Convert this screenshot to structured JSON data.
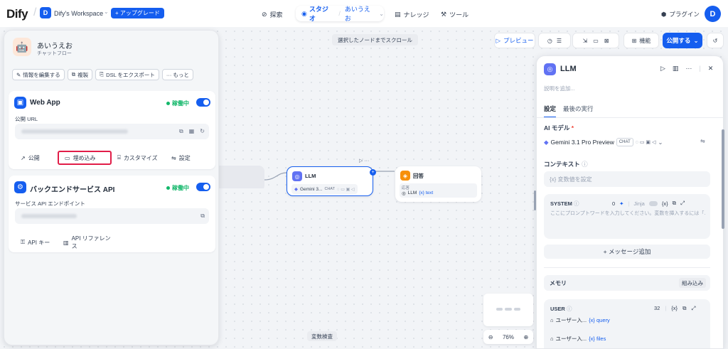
{
  "topbar": {
    "logo_main": "Dify",
    "workspace_initial": "D",
    "workspace_name": "Dify's Workspace",
    "upgrade_label": "+ アップグレード",
    "nav": {
      "explore": "探索",
      "studio": "スタジオ",
      "app_name": "あいうえお",
      "knowledge": "ナレッジ",
      "tools": "ツール"
    },
    "plugins_label": "プラグイン",
    "avatar_initial": "D"
  },
  "left_panel": {
    "app_name": "あいうえお",
    "app_type": "チャットフロー",
    "actions": [
      "情報を編集する",
      "複製",
      "DSL をエクスポート",
      "··· もっと"
    ],
    "web_app": {
      "title": "Web App",
      "status": "稼働中",
      "url_label": "公開 URL",
      "tabs": [
        "公開",
        "埋め込み",
        "カスタマイズ",
        "設定"
      ]
    },
    "backend_api": {
      "title": "バックエンドサービス API",
      "status": "稼働中",
      "endpoint_label": "サービス API エンドポイント",
      "links": [
        "API キー",
        "API リファレンス"
      ]
    }
  },
  "canvas": {
    "scroll_hint": "選択したノードまでスクロール",
    "llm_node": {
      "title": "LLM",
      "model": "Gemini 3...",
      "chip": "CHAT"
    },
    "answer_node": {
      "title": "回答",
      "label": "応答",
      "var_source": "LLM",
      "var_name": "{x} text"
    },
    "variable_inspect": "変数検査",
    "zoom": "76%"
  },
  "toolbar": {
    "preview": "プレビュー",
    "features": "機能",
    "publish": "公開する"
  },
  "right_panel": {
    "title": "LLM",
    "description_placeholder": "説明を追加...",
    "tabs": [
      "設定",
      "最後の実行"
    ],
    "ai_model_label": "AI モデル",
    "model_name": "Gemini 3.1 Pro Preview",
    "model_chip": "CHAT",
    "context_label": "コンテキスト",
    "context_placeholder": "{x}  変数値を設定",
    "system_label": "SYSTEM",
    "system_count": "0",
    "jinja_label": "Jinja",
    "system_placeholder": "ここにプロンプトワードを入力してください。変数を挿入するには「...",
    "add_message": "+ メッセージ追加",
    "memory_label": "メモリ",
    "memory_builtin": "組み込み",
    "user_label": "USER",
    "user_count": "32",
    "user_vars": [
      {
        "source": "ユーザー入...",
        "var": "{x} query"
      },
      {
        "source": "ユーザー入...",
        "var": "{x} files"
      }
    ]
  },
  "colors": {
    "primary": "#155eef",
    "success": "#12b76a",
    "highlight": "#e11d48"
  }
}
